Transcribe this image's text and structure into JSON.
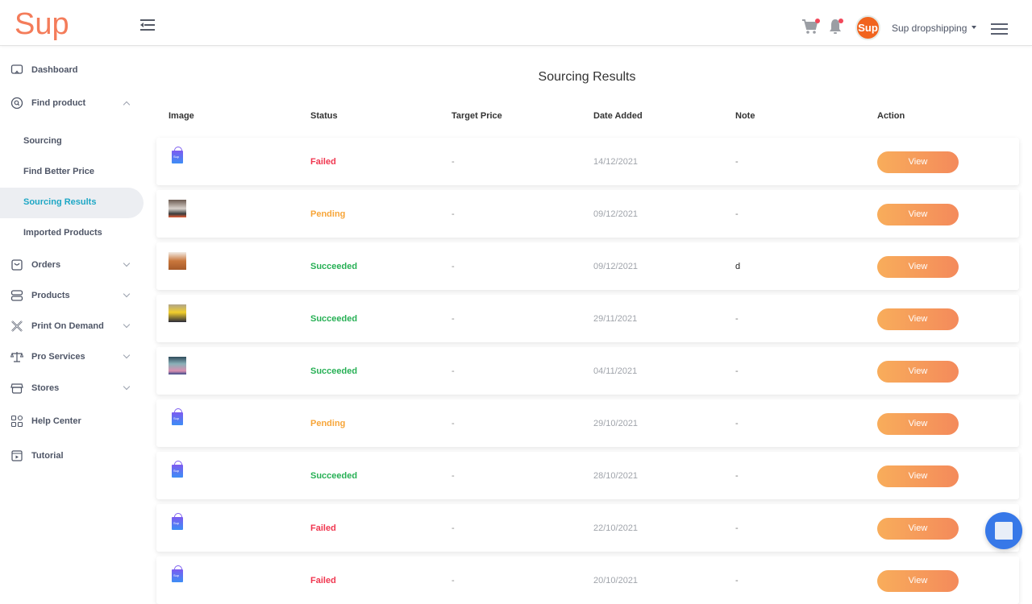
{
  "app": {
    "logo_text": "Sup",
    "brand_color": "#f47c5a"
  },
  "header": {
    "account_name": "Sup dropshipping",
    "avatar_text": "Sup",
    "icons": [
      "collapse-sidebar-icon",
      "cart-icon",
      "bell-icon",
      "hamburger-menu-icon"
    ]
  },
  "sidebar": {
    "items": [
      {
        "label": "Dashboard",
        "icon": "monitor-icon"
      },
      {
        "label": "Find product",
        "icon": "search-circle-icon",
        "expanded": true,
        "children": [
          {
            "label": "Sourcing"
          },
          {
            "label": "Find Better Price"
          },
          {
            "label": "Sourcing Results",
            "active": true
          },
          {
            "label": "Imported Products"
          }
        ]
      },
      {
        "label": "Orders",
        "icon": "bag-icon"
      },
      {
        "label": "Products",
        "icon": "server-icon"
      },
      {
        "label": "Print On Demand",
        "icon": "tools-icon"
      },
      {
        "label": "Pro Services",
        "icon": "scale-icon"
      },
      {
        "label": "Stores",
        "icon": "store-icon"
      },
      {
        "label": "Help Center",
        "icon": "grid-icon"
      },
      {
        "label": "Tutorial",
        "icon": "video-icon"
      }
    ]
  },
  "main": {
    "title": "Sourcing Results",
    "columns": [
      "Image",
      "Status",
      "Target Price",
      "Date Added",
      "Note",
      "Action"
    ],
    "status_colors": {
      "Failed": "#f0364f",
      "Pending": "#f7a539",
      "Succeeded": "#27b055"
    },
    "rows": [
      {
        "image": "sup-bag",
        "status": "Failed",
        "target_price": "-",
        "date": "14/12/2021",
        "note": "-",
        "action": "View"
      },
      {
        "image": "photo-clothes",
        "status": "Pending",
        "target_price": "-",
        "date": "09/12/2021",
        "note": "-",
        "action": "View"
      },
      {
        "image": "photo-basket",
        "status": "Succeeded",
        "target_price": "-",
        "date": "09/12/2021",
        "note": "d",
        "action": "View"
      },
      {
        "image": "photo-yellow",
        "status": "Succeeded",
        "target_price": "-",
        "date": "29/11/2021",
        "note": "-",
        "action": "View"
      },
      {
        "image": "photo-card",
        "status": "Succeeded",
        "target_price": "-",
        "date": "04/11/2021",
        "note": "-",
        "action": "View"
      },
      {
        "image": "sup-bag",
        "status": "Pending",
        "target_price": "-",
        "date": "29/10/2021",
        "note": "-",
        "action": "View"
      },
      {
        "image": "sup-bag",
        "status": "Succeeded",
        "target_price": "-",
        "date": "28/10/2021",
        "note": "-",
        "action": "View"
      },
      {
        "image": "sup-bag",
        "status": "Failed",
        "target_price": "-",
        "date": "22/10/2021",
        "note": "-",
        "action": "View"
      },
      {
        "image": "sup-bag",
        "status": "Failed",
        "target_price": "-",
        "date": "20/10/2021",
        "note": "-",
        "action": "View"
      }
    ]
  },
  "chat": {
    "icon": "chat-icon",
    "color": "#3778e8"
  }
}
